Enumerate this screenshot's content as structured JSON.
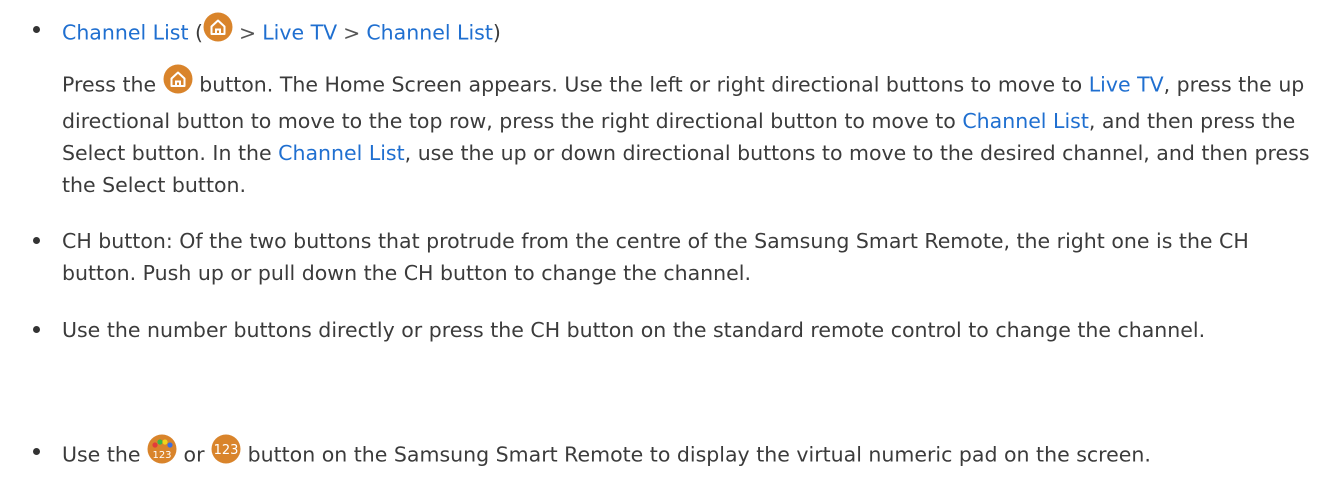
{
  "item1": {
    "title": "Channel List",
    "path_open": "(",
    "home_icon": "home-icon",
    "path_chevron_1": ">",
    "path_step_1": "Live TV",
    "path_chevron_2": ">",
    "path_step_2": "Channel List",
    "path_close": ")",
    "body": {
      "t1": "Press the",
      "t2": "button. The Home Screen appears. Use the left or right directional buttons to move to",
      "link1": "Live TV",
      "t3": ", press the up directional button to move to the top row, press the right directional button to move to",
      "link2": "Channel List",
      "t4": ", and then press the Select button. In the",
      "link3": "Channel List",
      "t5": ", use the up or down directional buttons to move to the desired channel, and then press the Select button."
    }
  },
  "item2": {
    "text": "CH button: Of the two buttons that protrude from the centre of the Samsung Smart Remote, the right one is the CH button. Push up or pull down the CH button to change the channel."
  },
  "item3": {
    "text": "Use the number buttons directly or press the CH button on the standard remote control to change the channel."
  },
  "item4": {
    "t1": "Use the",
    "icon_color_123": "color-123-icon",
    "t2": "or",
    "icon_123": "123-icon",
    "icon_123_label": "123",
    "t3": "button on the Samsung Smart Remote to display the virtual numeric pad on the screen."
  },
  "colors": {
    "link": "#1f6fd0",
    "text": "#3b3b3b",
    "icon_fill": "#d9842b"
  }
}
